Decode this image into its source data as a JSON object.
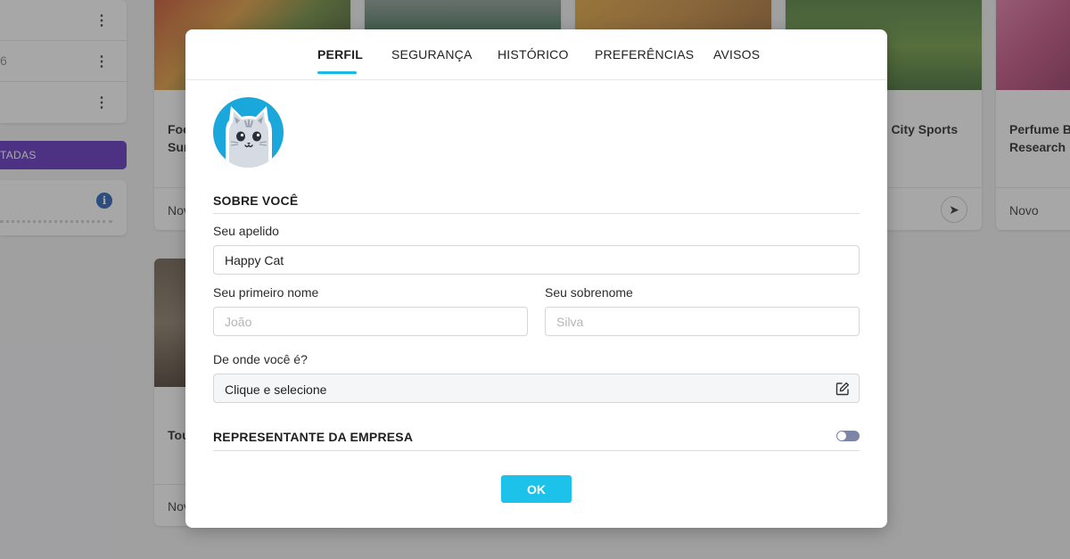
{
  "background": {
    "side_rows": [
      "",
      "6",
      ""
    ],
    "side_button_label": "TADAS",
    "cards": [
      {
        "title_lines": [
          "Foo",
          "Sur"
        ],
        "footer": "Nov"
      },
      {
        "title_lines": [
          "d City Sports"
        ],
        "footer": ""
      },
      {
        "title_lines": [
          "Perfume Br",
          "Research"
        ],
        "footer": "Novo"
      },
      {
        "title_lines": [
          "Tou"
        ],
        "footer": "Nov"
      }
    ],
    "colors": {
      "side_button": "#5b2bbf",
      "info_icon": "#1f5bb3"
    }
  },
  "modal": {
    "tabs": [
      {
        "label": "PERFIL",
        "active": true
      },
      {
        "label": "SEGURANÇA",
        "active": false
      },
      {
        "label": "HISTÓRICO",
        "active": false
      },
      {
        "label": "PREFERÊNCIAS",
        "active": false
      },
      {
        "label": "AVISOS",
        "active": false
      }
    ],
    "avatar_icon": "cat-avatar-icon",
    "about_section_title": "SOBRE VOCÊ",
    "nickname": {
      "label": "Seu apelido",
      "value": "Happy Cat"
    },
    "first_name": {
      "label": "Seu primeiro nome",
      "placeholder": "João",
      "value": ""
    },
    "last_name": {
      "label": "Seu sobrenome",
      "placeholder": "Silva",
      "value": ""
    },
    "origin": {
      "label": "De onde você é?",
      "value": "Clique e selecione",
      "icon": "edit-icon"
    },
    "company_rep": {
      "label": "REPRESENTANTE DA EMPRESA",
      "enabled": false
    },
    "ok_label": "OK",
    "colors": {
      "accent": "#1cb9e3",
      "ok_button": "#1cc2ea",
      "toggle_off": "#7d84a6",
      "avatar_bg": "#1aa7dc"
    }
  }
}
